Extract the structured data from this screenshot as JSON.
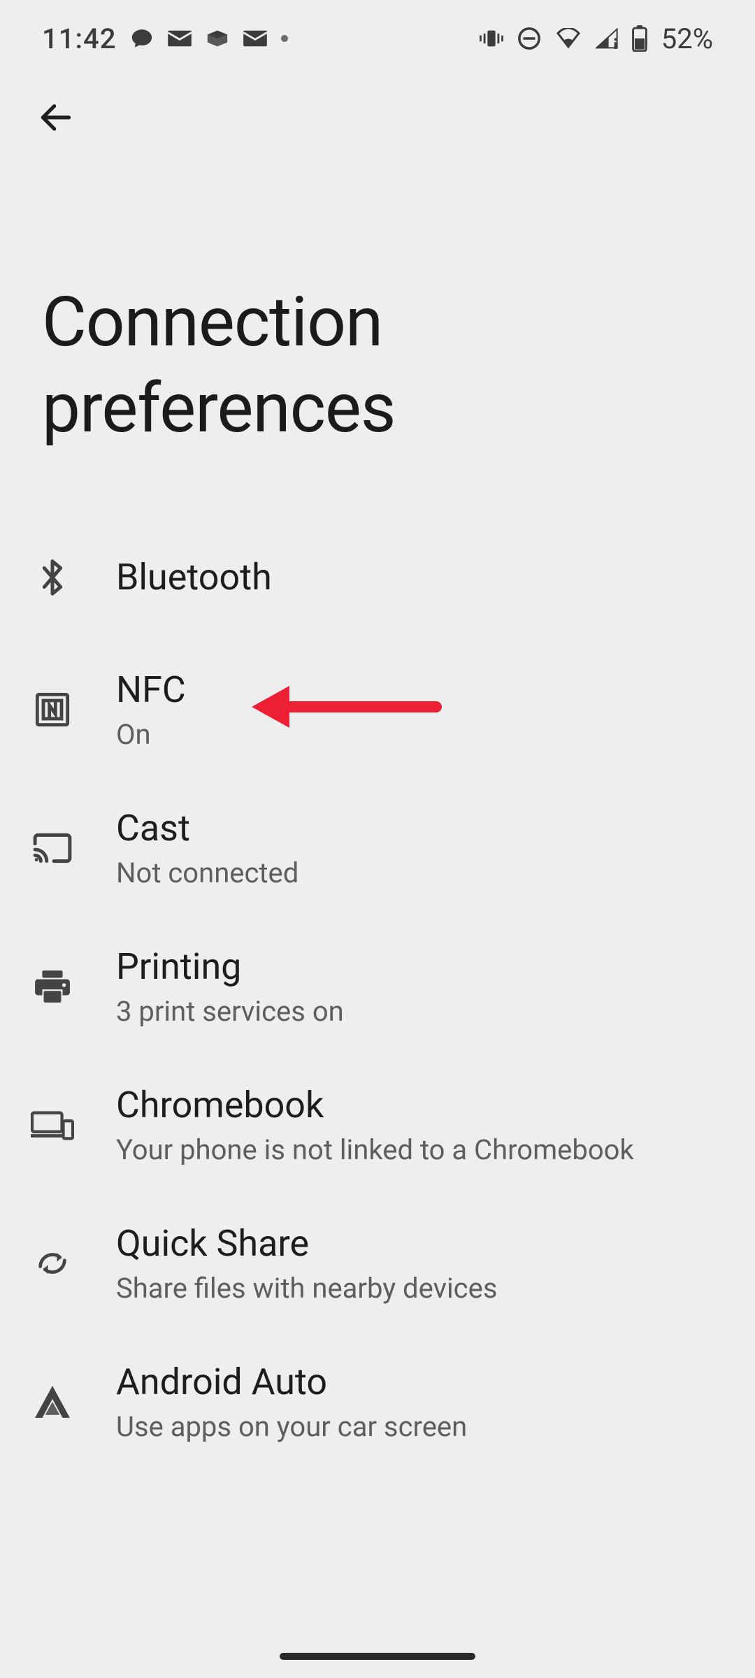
{
  "status": {
    "time": "11:42",
    "battery": "52%"
  },
  "header": {
    "title": "Connection preferences"
  },
  "items": [
    {
      "icon": "bluetooth-icon",
      "title": "Bluetooth",
      "sub": ""
    },
    {
      "icon": "nfc-icon",
      "title": "NFC",
      "sub": "On"
    },
    {
      "icon": "cast-icon",
      "title": "Cast",
      "sub": "Not connected"
    },
    {
      "icon": "print-icon",
      "title": "Printing",
      "sub": "3 print services on"
    },
    {
      "icon": "chromebook-icon",
      "title": "Chromebook",
      "sub": "Your phone is not linked to a Chromebook"
    },
    {
      "icon": "quick-share-icon",
      "title": "Quick Share",
      "sub": "Share files with nearby devices"
    },
    {
      "icon": "android-auto-icon",
      "title": "Android Auto",
      "sub": "Use apps on your car screen"
    }
  ],
  "annotation": {
    "color": "#ed1f34"
  }
}
